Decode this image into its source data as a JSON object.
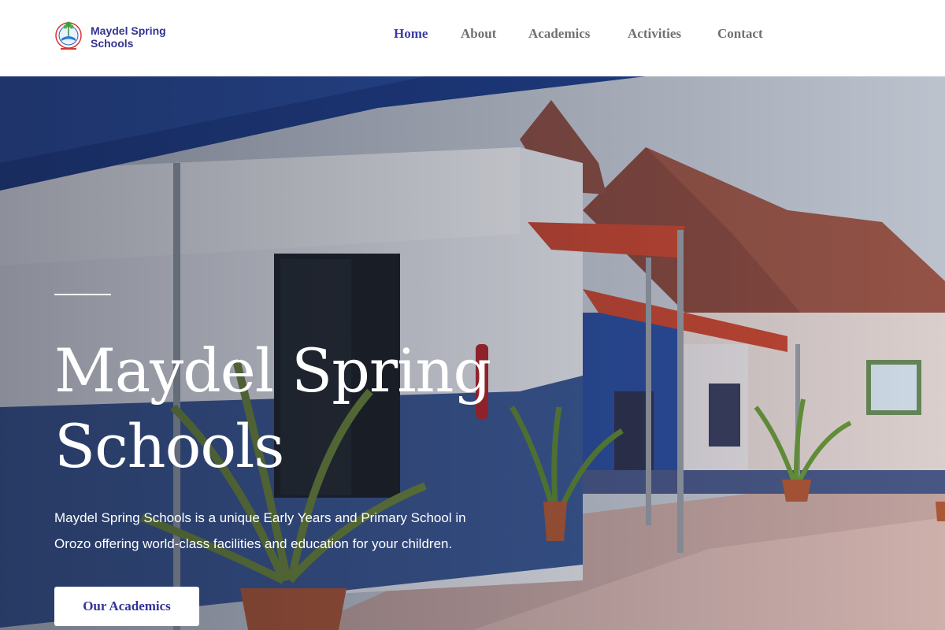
{
  "brand": {
    "name": "Maydel Spring Schools"
  },
  "nav": {
    "items": [
      {
        "label": "Home",
        "active": true
      },
      {
        "label": "About",
        "active": false
      },
      {
        "label": "Academics",
        "active": false
      },
      {
        "label": "Activities",
        "active": false
      },
      {
        "label": "Contact",
        "active": false
      }
    ]
  },
  "hero": {
    "title": "Maydel Spring Schools",
    "description": "Maydel Spring Schools is a unique Early Years and Primary School in Orozo offering world-class facilities and education for your children.",
    "cta_label": "Our Academics"
  },
  "colors": {
    "accent": "#3b3ba8",
    "nav_text": "#707070",
    "brand_text": "#33338f"
  },
  "icons": {
    "logo": "school-logo-icon"
  }
}
